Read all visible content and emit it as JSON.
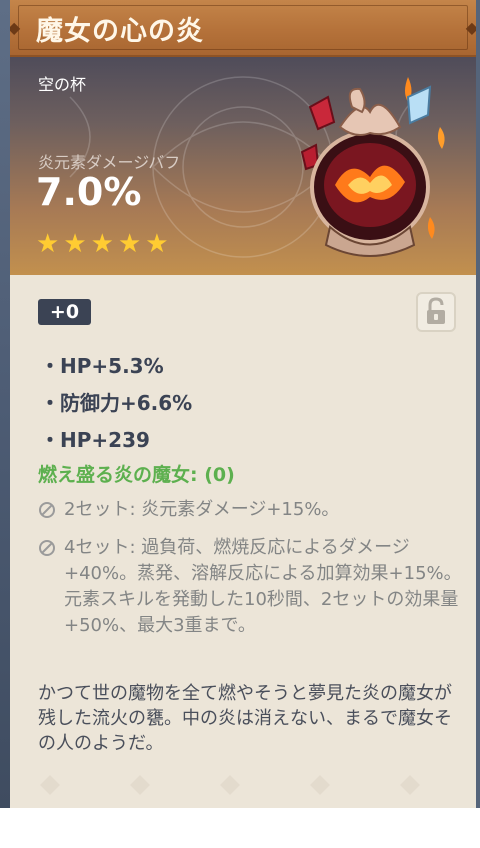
{
  "header": {
    "title": "魔女の心の炎"
  },
  "artifact": {
    "type": "空の杯",
    "main_stat_name": "炎元素ダメージバフ",
    "main_stat_value": "7.0%",
    "rarity_stars": 5,
    "level": "+0",
    "locked": false
  },
  "substats": [
    "・HP+5.3%",
    "・防御力+6.6%",
    "・HP+239"
  ],
  "set": {
    "name": "燃え盛る炎の魔女: (0)",
    "effects": [
      "2セット: 炎元素ダメージ+15%。",
      "4セット: 過負荷、燃焼反応によるダメージ+40%。蒸発、溶解反応による加算効果+15%。元素スキルを発動した10秒間、2セットの効果量+50%、最大3重まで。"
    ]
  },
  "flavor_text": "かつて世の魔物を全て燃やそうと夢見た炎の魔女が残した流火の甕。中の炎は消えない、まるで魔女その人のようだ。",
  "colors": {
    "header_orange": "#b5723a",
    "star_gold": "#ffcc32",
    "set_green": "#5db04f",
    "level_badge": "#3b4354",
    "card_bg": "#ece5d8"
  }
}
